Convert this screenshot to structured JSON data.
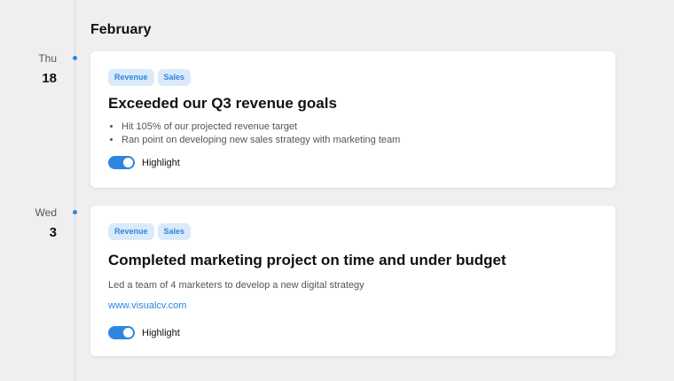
{
  "timeline": {
    "month": "February",
    "entries": [
      {
        "day_of_week": "Thu",
        "day": "18",
        "tags": [
          "Revenue",
          "Sales"
        ],
        "title": "Exceeded our Q3 revenue goals",
        "bullets": [
          "Hit 105% of our projected revenue target",
          "Ran point on developing new sales strategy with marketing team"
        ],
        "highlight_label": "Highlight",
        "highlight_on": true
      },
      {
        "day_of_week": "Wed",
        "day": "3",
        "tags": [
          "Revenue",
          "Sales"
        ],
        "title": "Completed marketing project on time and under budget",
        "description": "Led a team of 4 marketers to develop a new digital strategy",
        "link": "www.visualcv.com",
        "highlight_label": "Highlight",
        "highlight_on": true
      }
    ]
  },
  "colors": {
    "accent": "#2e86de",
    "tag_background": "#dbeafb",
    "page_background": "#efefef"
  }
}
